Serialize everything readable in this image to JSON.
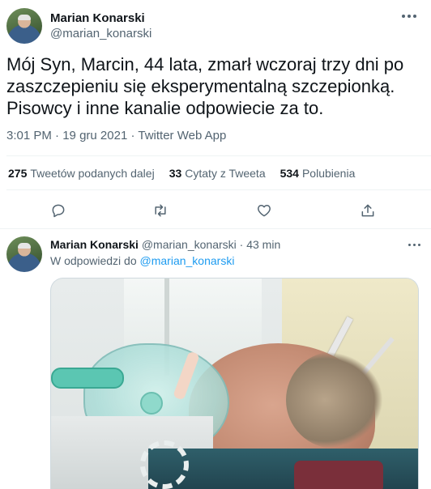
{
  "tweet": {
    "author_name": "Marian Konarski",
    "author_handle": "@marian_konarski",
    "text": "Mój Syn, Marcin, 44 lata, zmarł wczoraj trzy dni po zaszczepieniu się eksperymentalną szczepionką.\nPisowcy i inne kanalie odpowiecie za to.",
    "time": "3:01 PM",
    "date": "19 gru 2021",
    "source": "Twitter Web App",
    "separator": "·"
  },
  "stats": [
    {
      "count": "275",
      "label": "Tweetów podanych dalej"
    },
    {
      "count": "33",
      "label": "Cytaty z Tweeta"
    },
    {
      "count": "534",
      "label": "Polubienia"
    }
  ],
  "actions": [
    "reply-icon",
    "retweet-icon",
    "like-icon",
    "share-icon"
  ],
  "reply": {
    "author_name": "Marian Konarski",
    "author_handle": "@marian_konarski",
    "separator": "·",
    "time_ago": "43 min",
    "replying_prefix": "W odpowiedzi do",
    "replying_handle": "@marian_konarski"
  },
  "colors": {
    "text": "#0f1419",
    "muted": "#536471",
    "link": "#1d9bf0",
    "divider": "#eff3f4"
  }
}
